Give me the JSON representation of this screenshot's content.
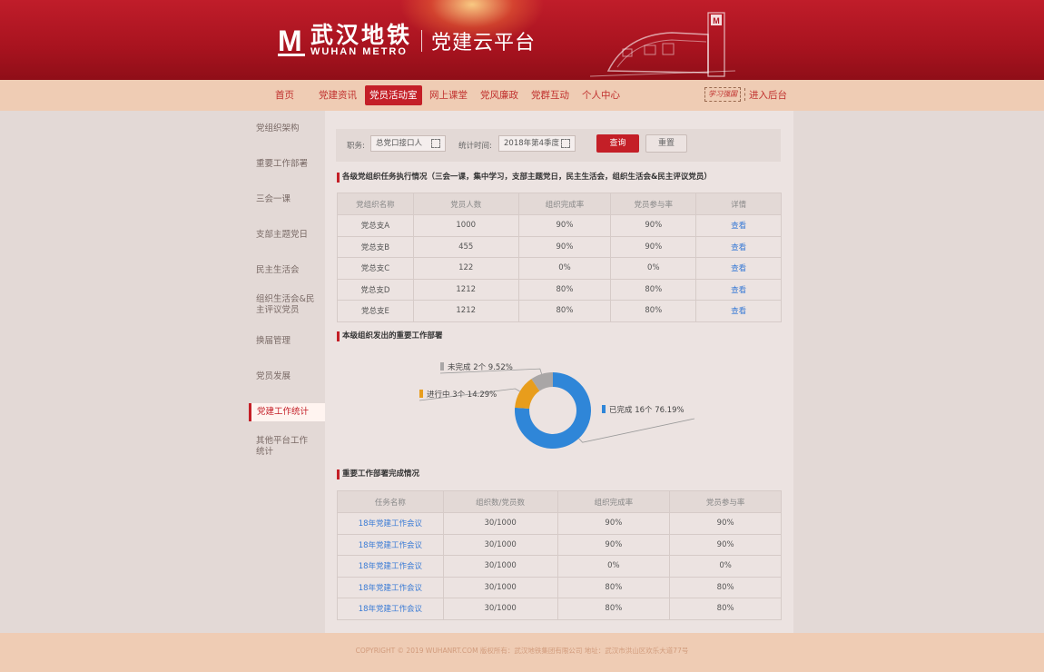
{
  "header": {
    "logo_cn": "武汉地铁",
    "logo_en": "WUHAN METRO",
    "platform_title": "党建云平台"
  },
  "nav": {
    "items": [
      {
        "label": "首页"
      },
      {
        "label": "党建资讯"
      },
      {
        "label": "党员活动室",
        "active": true
      },
      {
        "label": "网上课堂"
      },
      {
        "label": "党风廉政"
      },
      {
        "label": "党群互动"
      },
      {
        "label": "个人中心"
      }
    ],
    "badge": "学习强国",
    "backend_label": "进入后台"
  },
  "sidebar": {
    "items": [
      {
        "label": "党组织架构"
      },
      {
        "label": "重要工作部署"
      },
      {
        "label": "三会一课"
      },
      {
        "label": "支部主题党日"
      },
      {
        "label": "民主生活会"
      },
      {
        "label": "组织生活会&民主评议党员"
      },
      {
        "label": "换届管理"
      },
      {
        "label": "党员发展"
      },
      {
        "label": "党建工作统计",
        "active": true
      },
      {
        "label": "其他平台工作统计"
      }
    ]
  },
  "filter": {
    "position_label": "职务:",
    "position_value": "总党口接口人",
    "time_label": "统计时间:",
    "time_value": "2018年第4季度",
    "query_label": "查询",
    "reset_label": "重置"
  },
  "section1": {
    "title": "各级党组织任务执行情况（三会一课，集中学习，支部主题党日，民主生活会，组织生活会&民主评议党员）",
    "columns": [
      "党组织名称",
      "党员人数",
      "组织完成率",
      "党员参与率",
      "详情"
    ],
    "rows": [
      [
        "党总支A",
        "1000",
        "90%",
        "90%",
        "查看"
      ],
      [
        "党总支B",
        "455",
        "90%",
        "90%",
        "查看"
      ],
      [
        "党总支C",
        "122",
        "0%",
        "0%",
        "查看"
      ],
      [
        "党总支D",
        "1212",
        "80%",
        "80%",
        "查看"
      ],
      [
        "党总支E",
        "1212",
        "80%",
        "80%",
        "查看"
      ]
    ]
  },
  "section2": {
    "title": "本级组织发出的重要工作部署"
  },
  "chart_data": {
    "type": "pie",
    "donut": true,
    "categories": [
      "已完成",
      "进行中",
      "未完成"
    ],
    "values": [
      16,
      3,
      2
    ],
    "labels": [
      "已完成  16个  76.19%",
      "进行中  3个  14.29%",
      "未完成  2个  9.52%"
    ],
    "colors": [
      "#2f86d8",
      "#e89d1c",
      "#a9a6a6"
    ]
  },
  "section3": {
    "title": "重要工作部署完成情况",
    "columns": [
      "任务名称",
      "组织数/党员数",
      "组织完成率",
      "党员参与率"
    ],
    "rows": [
      [
        "18年党建工作会议",
        "30/1000",
        "90%",
        "90%"
      ],
      [
        "18年党建工作会议",
        "30/1000",
        "90%",
        "90%"
      ],
      [
        "18年党建工作会议",
        "30/1000",
        "0%",
        "0%"
      ],
      [
        "18年党建工作会议",
        "30/1000",
        "80%",
        "80%"
      ],
      [
        "18年党建工作会议",
        "30/1000",
        "80%",
        "80%"
      ]
    ]
  },
  "footer": {
    "text": "COPYRIGHT © 2019 WUHANRT.COM  版权所有：武汉地铁集团有限公司  地址：武汉市洪山区欢乐大道77号"
  }
}
